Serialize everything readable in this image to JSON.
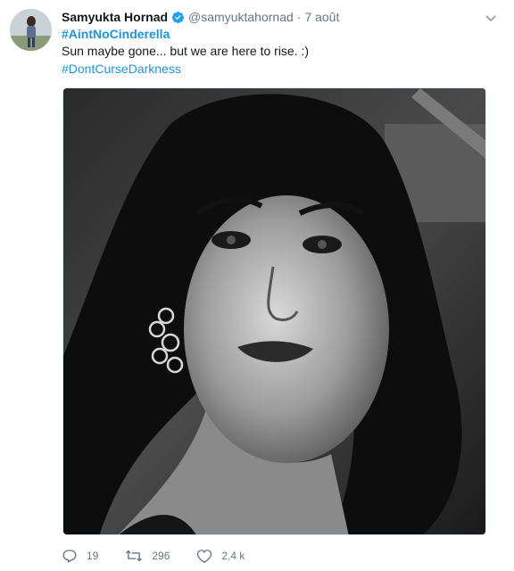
{
  "tweet": {
    "author_name": "Samyukta Hornad",
    "handle": "@samyuktahornad",
    "separator": "·",
    "date": "7 août",
    "hashtag_1": "#AintNoCinderella",
    "text": "Sun maybe gone... but we are here to rise. :)",
    "hashtag_2": "#DontCurseDarkness"
  },
  "actions": {
    "reply_count": "19",
    "retweet_count": "296",
    "like_count": "2,4 k"
  },
  "icons": {
    "verified": "verified-badge-icon",
    "caret": "chevron-down-icon",
    "reply": "reply-icon",
    "retweet": "retweet-icon",
    "like": "heart-icon"
  },
  "colors": {
    "link": "#1b95e0",
    "muted": "#657786",
    "text": "#14171a"
  }
}
